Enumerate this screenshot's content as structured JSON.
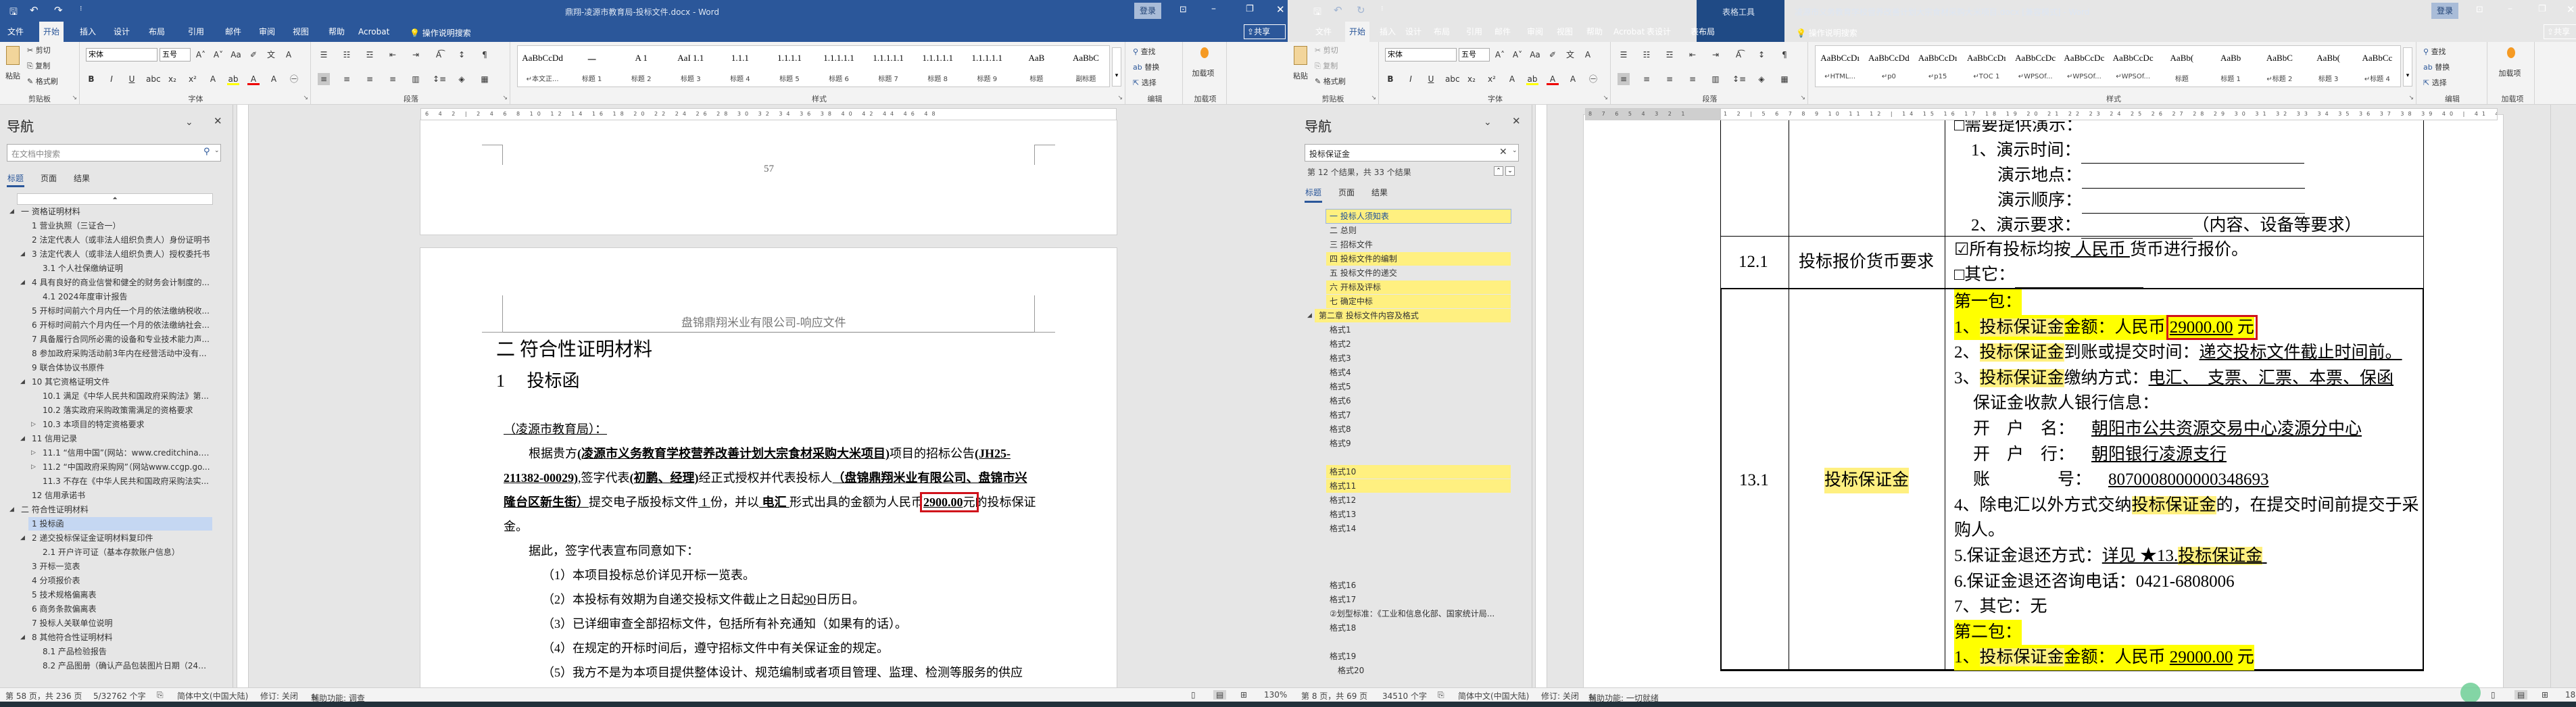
{
  "colors": {
    "title_bar": "#2b579a",
    "search_hit": "#fff080",
    "highlight": "#ffff00",
    "red_box": "#d0121b",
    "selected_nav": "#c5d7f2"
  },
  "left": {
    "title": "鼎翔-凌源市教育局-投标文件.docx - Word",
    "signin": "登录",
    "share": "共享",
    "tabs": [
      "文件",
      "开始",
      "插入",
      "设计",
      "布局",
      "引用",
      "邮件",
      "审阅",
      "视图",
      "帮助",
      "Acrobat"
    ],
    "active_tab": 1,
    "tell_me": "操作说明搜索",
    "ribbon": {
      "clipboard": {
        "paste": "粘贴",
        "cut": "剪切",
        "copy": "复制",
        "format_painter": "格式刷",
        "label": "剪贴板"
      },
      "font": {
        "name": "宋体",
        "size": "五号",
        "label": "字体",
        "row1_icons": [
          "grow-font",
          "shrink-font",
          "change-case",
          "clear-formatting",
          "phonetic-guide",
          "character-border"
        ],
        "row2_icons": [
          "bold",
          "italic",
          "underline",
          "strikethrough",
          "subscript",
          "superscript",
          "text-effects",
          "highlight",
          "font-color",
          "character-shading",
          "enclose-characters"
        ]
      },
      "paragraph": {
        "label": "段落",
        "row1_icons": [
          "bullets",
          "numbering",
          "multilevel-list",
          "decrease-indent",
          "increase-indent",
          "chinese-layout",
          "sort",
          "show-marks"
        ],
        "row2_icons": [
          "align-left",
          "center",
          "align-right",
          "justify",
          "distributed",
          "line-spacing",
          "shading",
          "borders"
        ]
      },
      "styles": {
        "label": "样式",
        "items": [
          {
            "preview": "AaBbCcDd",
            "name": "↵本文正..."
          },
          {
            "preview": "一",
            "name": "标题 1"
          },
          {
            "preview": "A 1",
            "name": "标题 2"
          },
          {
            "preview": "AaI 1.1",
            "name": "标题 3"
          },
          {
            "preview": "1.1.1",
            "name": "标题 4"
          },
          {
            "preview": "1.1.1.1",
            "name": "标题 5"
          },
          {
            "preview": "1.1.1.1.1",
            "name": "标题 6"
          },
          {
            "preview": "1.1.1.1.1",
            "name": "标题 7"
          },
          {
            "preview": "1.1.1.1.1",
            "name": "标题 8"
          },
          {
            "preview": "1.1.1.1.1",
            "name": "标题 9"
          },
          {
            "preview": "AaB",
            "name": "标题"
          },
          {
            "preview": "AaBbC",
            "name": "副标题"
          }
        ]
      },
      "editing": {
        "find": "查找",
        "replace": "替换",
        "select": "选择",
        "label": "编辑"
      },
      "addins": {
        "button": "加载项",
        "label": "加载项"
      }
    },
    "nav": {
      "title": "导航",
      "search_placeholder": "在文档中搜索",
      "tabs": [
        "标题",
        "页面",
        "结果"
      ],
      "items": [
        {
          "label": "一 资格证明材料",
          "level": 0,
          "expander": "expanded"
        },
        {
          "label": "1 营业执照（三证合一）",
          "level": 1,
          "expander": ""
        },
        {
          "label": "2 法定代表人（或非法人组织负责人）身份证明书",
          "level": 1,
          "expander": ""
        },
        {
          "label": "3 法定代表人（或非法人组织负责人）授权委托书",
          "level": 1,
          "expander": "expanded"
        },
        {
          "label": "3.1 个人社保缴纳证明",
          "level": 2,
          "expander": ""
        },
        {
          "label": "4 具有良好的商业信誉和健全的财务会计制度的...",
          "level": 1,
          "expander": "expanded"
        },
        {
          "label": "4.1 2024年度审计报告",
          "level": 2,
          "expander": ""
        },
        {
          "label": "5 开标时间前六个月内任一个月的依法缴纳税收...",
          "level": 1,
          "expander": ""
        },
        {
          "label": "6 开标时间前六个月内任一个月的依法缴纳社会...",
          "level": 1,
          "expander": ""
        },
        {
          "label": "7 具备履行合同所必需的设备和专业技术能力声...",
          "level": 1,
          "expander": ""
        },
        {
          "label": "8 参加政府采购活动前3年内在经营活动中没有...",
          "level": 1,
          "expander": ""
        },
        {
          "label": "9 联合体协议书原件",
          "level": 1,
          "expander": ""
        },
        {
          "label": "10 其它资格证明文件",
          "level": 1,
          "expander": "expanded"
        },
        {
          "label": "10.1 满足《中华人民共和国政府采购法》第...",
          "level": 2,
          "expander": ""
        },
        {
          "label": "10.2 落实政府采购政策需满足的资格要求",
          "level": 2,
          "expander": ""
        },
        {
          "label": "10.3 本项目的特定资格要求",
          "level": 2,
          "expander": "collapsed"
        },
        {
          "label": "11 信用记录",
          "level": 1,
          "expander": "expanded"
        },
        {
          "label": "11.1 “信用中国”(网站：www.creditchina.go...",
          "level": 2,
          "expander": "collapsed"
        },
        {
          "label": "11.2 “中国政府采购网”（网站www.ccgp.go...",
          "level": 2,
          "expander": "collapsed"
        },
        {
          "label": "11.3 不存在《中华人民共和国政府采购法实...",
          "level": 2,
          "expander": ""
        },
        {
          "label": "12 信用承诺书",
          "level": 1,
          "expander": ""
        },
        {
          "label": "二 符合性证明材料",
          "level": 0,
          "expander": "expanded"
        },
        {
          "label": "1 投标函",
          "level": 1,
          "expander": "",
          "selected": true
        },
        {
          "label": "2 递交投标保证金证明材料复印件",
          "level": 1,
          "expander": "expanded"
        },
        {
          "label": "2.1 开户许可证（基本存款账户信息）",
          "level": 2,
          "expander": ""
        },
        {
          "label": "3 开标一览表",
          "level": 1,
          "expander": ""
        },
        {
          "label": "4 分项报价表",
          "level": 1,
          "expander": ""
        },
        {
          "label": "5 技术规格偏离表",
          "level": 1,
          "expander": ""
        },
        {
          "label": "6 商务条款偏离表",
          "level": 1,
          "expander": ""
        },
        {
          "label": "7 投标人关联单位说明",
          "level": 1,
          "expander": ""
        },
        {
          "label": "8 其他符合性证明材料",
          "level": 1,
          "expander": "expanded"
        },
        {
          "label": "8.1 产品检验报告",
          "level": 2,
          "expander": ""
        },
        {
          "label": "8.2 产品图册（确认产品包装图片日期（24年...",
          "level": 2,
          "expander": ""
        }
      ]
    },
    "ruler_ticks": "6 4 2 | 2 4 6 8 10 12 14 16 18 20 22 24 26 28 30 32 34 36 38 40 42 44 46 48",
    "doc": {
      "prev_page_number": "57",
      "header": "盘锦鼎翔米业有限公司-响应文件",
      "h1": "二 符合性证明材料",
      "h2_num": "1",
      "h2_title": "投标函",
      "addressee": "（凌源市教育局）：",
      "p1": {
        "a": "根据贵方",
        "project": "(凌源市义务教育学校营养改善计划大宗食材采购大米项目)",
        "b": "项目的招标公告",
        "code": "(JH25-211382-00029)",
        "c": ",签字代表",
        "rep": "(初鹏、经理)",
        "d": "经正式授权并代表投标人",
        "bidder": "（盘锦鼎翔米业有限公司、盘锦市兴隆台区新生街）",
        "e": "提交电子版投标文件",
        "copies": " 1 ",
        "f": "份，并以",
        "method": " 电汇 ",
        "g": "形式出具的金额为人民币",
        "amount": "2900.00",
        "unit": "元",
        "h": "的投标保证金。"
      },
      "p2": "据此，签字代表宣布同意如下：",
      "items": [
        "（1）本项目投标总价详见开标一览表。",
        "（2）本投标有效期为自递交投标文件截止之日起",
        "（3）已详细审查全部招标文件，包括所有补充通知（如果有的话）。",
        "（4）在规定的开标时间后，遵守招标文件中有关保证金的规定。",
        "（5）我方不是为本项目提供整体设计、规范编制或者项目管理、监理、检测等服务的供应"
      ],
      "validity_days": "90",
      "item2_tail": "日历日。"
    },
    "status": {
      "page": "第 58 页，共 236 页",
      "words": "5/32762 个字",
      "language": "简体中文(中国大陆)",
      "track": "修订: 关闭",
      "accessibility": "辅助功能: 调查",
      "zoom": "130%"
    }
  },
  "right": {
    "title": "凌源市义务教育学校营养改善计划大宗食材采购大米项目.docx [兼容模式] - Word",
    "context_tools": "表格工具",
    "signin": "登录",
    "share": "共享",
    "tabs": [
      "文件",
      "开始",
      "插入",
      "设计",
      "布局",
      "引用",
      "邮件",
      "审阅",
      "视图",
      "帮助",
      "Acrobat",
      "表设计",
      "表布局"
    ],
    "active_tab": 1,
    "tell_me": "操作说明搜索",
    "ribbon": {
      "clipboard": {
        "paste": "粘贴",
        "cut": "剪切",
        "copy": "复制",
        "format_painter": "格式刷",
        "label": "剪贴板"
      },
      "font": {
        "name": "宋体",
        "size": "五号",
        "label": "字体",
        "row1_icons": [
          "grow-font",
          "shrink-font",
          "change-case",
          "clear-formatting",
          "phonetic-guide",
          "character-border"
        ],
        "row2_icons": [
          "bold",
          "italic",
          "underline",
          "strikethrough",
          "subscript",
          "superscript",
          "text-effects",
          "highlight",
          "font-color",
          "character-shading",
          "enclose-characters"
        ]
      },
      "paragraph": {
        "label": "段落",
        "row1_icons": [
          "bullets",
          "numbering",
          "multilevel-list",
          "decrease-indent",
          "increase-indent",
          "chinese-layout",
          "sort",
          "show-marks"
        ],
        "row2_icons": [
          "align-left",
          "center",
          "align-right",
          "justify",
          "distributed",
          "line-spacing",
          "shading",
          "borders"
        ]
      },
      "styles": {
        "label": "样式",
        "items": [
          {
            "preview": "AaBbCcDı",
            "name": "↵HTML..."
          },
          {
            "preview": "AaBbCcDd",
            "name": "↵p0"
          },
          {
            "preview": "AaBbCcDı",
            "name": "↵p15"
          },
          {
            "preview": "AaBbCcDı",
            "name": "↵TOC 1"
          },
          {
            "preview": "AaBbCcDc",
            "name": "↵WPSOf..."
          },
          {
            "preview": "AaBbCcDc",
            "name": "↵WPSOf..."
          },
          {
            "preview": "AaBbCcDc",
            "name": "↵WPSOf..."
          },
          {
            "preview": "AaBb(",
            "name": "标题"
          },
          {
            "preview": "AaBb",
            "name": "标题 1"
          },
          {
            "preview": "AaBbC",
            "name": "↵标题 2"
          },
          {
            "preview": "AaBb(",
            "name": "标题 3"
          },
          {
            "preview": "AaBbCc",
            "name": "↵标题 4"
          }
        ]
      },
      "editing": {
        "find": "查找",
        "replace": "替换",
        "select": "选择",
        "label": "编辑"
      },
      "addins": {
        "button": "加载项",
        "label": "加载项"
      }
    },
    "nav": {
      "title": "导航",
      "search_value": "投标保证金",
      "result_text": "第 12 个结果，共 33 个结果",
      "tabs": [
        "标题",
        "页面",
        "结果"
      ],
      "items": [
        {
          "label": "一 投标人须知表",
          "level": 1,
          "highlight": true,
          "current": true
        },
        {
          "label": "二 总则",
          "level": 1
        },
        {
          "label": "三 招标文件",
          "level": 1
        },
        {
          "label": "四 投标文件的编制",
          "level": 1,
          "highlight": true
        },
        {
          "label": "五 投标文件的递交",
          "level": 1
        },
        {
          "label": "六 开标及评标",
          "level": 1,
          "highlight": true
        },
        {
          "label": "七 确定中标",
          "level": 1,
          "highlight": true
        },
        {
          "label": "第二章 投标文件内容及格式",
          "level": 0,
          "expander": "expanded",
          "highlight": true
        },
        {
          "label": "格式1",
          "level": 1
        },
        {
          "label": "格式2",
          "level": 1
        },
        {
          "label": "格式3",
          "level": 1
        },
        {
          "label": "格式4",
          "level": 1
        },
        {
          "label": "格式5",
          "level": 1
        },
        {
          "label": "格式6",
          "level": 1
        },
        {
          "label": "格式7",
          "level": 1
        },
        {
          "label": "格式8",
          "level": 1
        },
        {
          "label": "格式9",
          "level": 1
        },
        {
          "label": "",
          "level": 1
        },
        {
          "label": "格式10",
          "level": 1,
          "highlight": true
        },
        {
          "label": "格式11",
          "level": 1,
          "highlight": true
        },
        {
          "label": "格式12",
          "level": 1
        },
        {
          "label": "格式13",
          "level": 1
        },
        {
          "label": "格式14",
          "level": 1
        },
        {
          "label": "",
          "level": 1
        },
        {
          "label": "",
          "level": 1
        },
        {
          "label": "",
          "level": 1
        },
        {
          "label": "格式16",
          "level": 1
        },
        {
          "label": "格式17",
          "level": 1
        },
        {
          "label": " ②划型标准：《工业和信息化部、国家统计局...",
          "level": 1
        },
        {
          "label": "格式18",
          "level": 1
        },
        {
          "label": "",
          "level": 1
        },
        {
          "label": "格式19",
          "level": 1
        },
        {
          "label": "格式20",
          "level": 2
        }
      ]
    },
    "vruler": "8 7 6 5 4 3 2 1",
    "ruler_ticks": "1 2 | 5 6 7 8 9 10 11 12 | 14 15 16 17 18 19 20 21 22 23 24 25 26 27 28 29 30 31 32 33 34 35 36 37 38 39 40 | 41 42",
    "doc": {
      "demo": {
        "top": "□需要提供演示：",
        "time": "1、演示时间：",
        "place": "演示地点：",
        "order": "演示顺序：",
        "req": "2、演示要求：",
        "req_tail": "（内容、设备等要求）"
      },
      "currency": {
        "no": "12.1",
        "item": "投标报价货币要求",
        "line1_a": "☑所有投标均按",
        "line1_cur": " 人民币 ",
        "line1_b": "货币进行报价。",
        "line2": "□其它："
      },
      "deposit": {
        "no": "13.1",
        "item": "投标保证金",
        "hit": "投标保证金",
        "pkg1": "第一包：",
        "l1_a": "1、",
        "l1_b": "金额：人民币 ",
        "amount": "29000.00",
        "unit": "元",
        "l2_a": "2、",
        "l2_b": "到账或提交时间：",
        "l2_c": "递交投标文件截止时间前。",
        "l3_a": "3、",
        "l3_b": "缴纳方式：",
        "l3_c": "电汇、　支票、汇票、本票、保函",
        "bank_info": "保证金收款人银行信息：",
        "acct_name_label": "开　户　名：",
        "acct_name": "朝阳市公共资源交易中心凌源分中心",
        "bank_label": "开　户　行：",
        "bank": "朝阳银行凌源支行",
        "acct_no_label": "账　　　　号：",
        "acct_no": "8070008000000348693",
        "l4_a": "4、除电汇以外方式交纳",
        "l4_b": "的，在提交时间前提交于采",
        "l4_c": "购人。",
        "l5_a": "5.保证金退还方式：",
        "l5_b": "详见 ★13.",
        "l6": "6.保证金退还咨询电话：0421-6808006",
        "l7": "7、其它：无",
        "pkg2": "第二包："
      }
    },
    "status": {
      "page": "第 8 页，共 69 页",
      "words": "34510 个字",
      "language": "简体中文(中国大陆)",
      "track": "修订: 关闭",
      "accessibility": "辅助功能: 一切就绪",
      "zoom": "18"
    }
  }
}
